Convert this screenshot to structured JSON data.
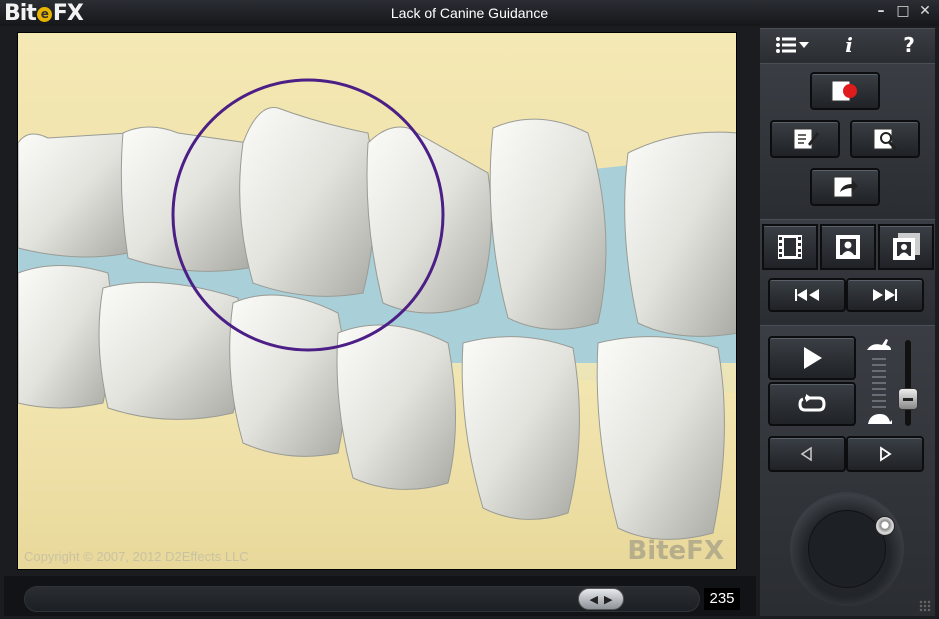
{
  "window": {
    "logo_prefix": "Bit",
    "logo_e": "e",
    "logo_suffix": "FX",
    "title": "Lack of Canine Guidance",
    "minimize": "–",
    "maximize": "□",
    "close": "✕"
  },
  "viewport": {
    "copyright": "Copyright © 2007, 2012 D2Effects LLC",
    "watermark": "BiteFX"
  },
  "timeline": {
    "frame": "235",
    "progress": 0.88
  },
  "panel": {
    "menu_icon": "list-menu-icon",
    "info_label": "i",
    "help_label": "?",
    "record_icon": "record-icon",
    "edit_icon": "edit-notes-icon",
    "find_icon": "search-notes-icon",
    "export_icon": "export-icon",
    "film_icon": "film-icon",
    "photo_icon": "portrait-icon",
    "photos_icon": "portraits-icon",
    "prev_icon": "skip-back-icon",
    "next_icon": "skip-forward-icon",
    "play_icon": "play-icon",
    "loop_icon": "loop-icon",
    "step_back_icon": "step-back-icon",
    "step_fwd_icon": "step-forward-icon",
    "speed_fast_icon": "rabbit-icon",
    "speed_slow_icon": "turtle-icon",
    "speed_level": 0.25
  },
  "colors": {
    "accent_record": "#e01b1b",
    "circle": "#4b1f86",
    "gum": "#efe3a8",
    "background_blue": "#a9cfd8"
  }
}
